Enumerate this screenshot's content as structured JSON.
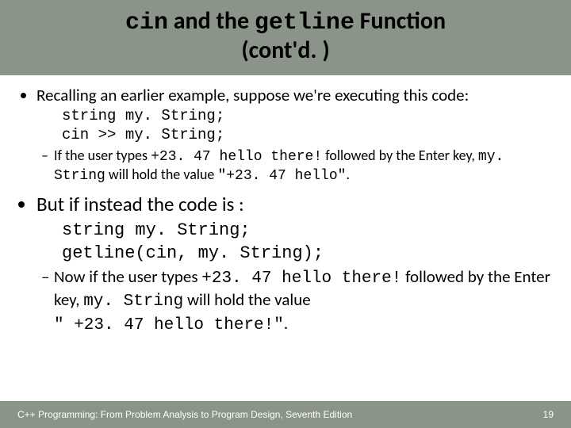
{
  "title": {
    "line1_pre": "cin",
    "line1_mid": " and the ",
    "line1_code": "getline",
    "line1_post": " Function",
    "line2": "(cont'd. )"
  },
  "bullet1": "Recalling an earlier example, suppose we're executing this code:",
  "code1": {
    "l1": "string my. String;",
    "l2": "cin >> my. String;"
  },
  "sub1": {
    "pre": "If the user types  ",
    "typed": "+23. 47 hello there!",
    "mid": " followed by the Enter key, ",
    "var": "my. String",
    "post": "  will hold the value ",
    "val": "\"+23. 47 hello\"",
    "end": "."
  },
  "bullet2": "But if instead the code is :",
  "code2": {
    "l1": "string my. String;",
    "l2": "getline(cin, my. String);"
  },
  "sub2": {
    "pre": "Now if the user types  ",
    "typed": "+23. 47 hello there!",
    "mid": " followed by the Enter key, ",
    "var": "my. String",
    "post": "  will hold the value ",
    "val": "\" +23. 47 hello there!\"",
    "end": "."
  },
  "footer": {
    "source": "C++ Programming: From Problem Analysis to Program Design, Seventh Edition",
    "page": "19"
  },
  "chart_data": null
}
